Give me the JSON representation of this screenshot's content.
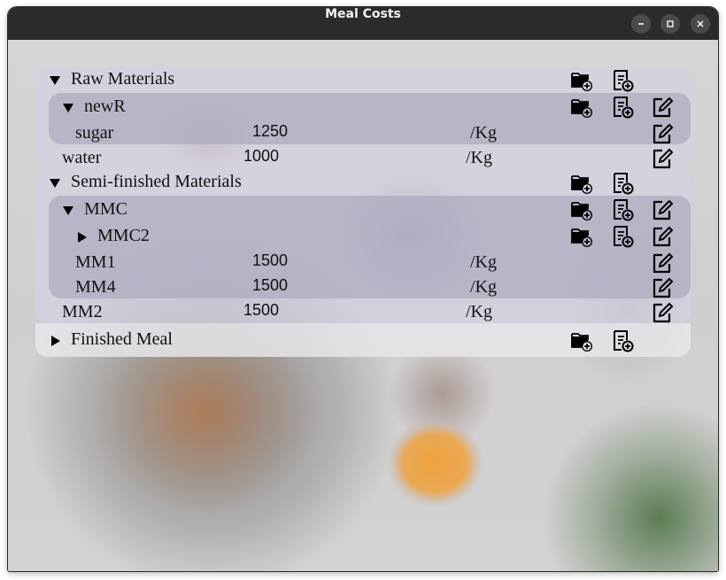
{
  "window": {
    "title": "Meal Costs"
  },
  "tree": {
    "raw": {
      "label": "Raw Materials",
      "children": {
        "newR": {
          "label": "newR",
          "items": [
            {
              "name": "sugar",
              "price": "1250",
              "unit": "/Kg"
            }
          ]
        }
      },
      "items": [
        {
          "name": "water",
          "price": "1000",
          "unit": "/Kg"
        }
      ]
    },
    "semi": {
      "label": "Semi-finished Materials",
      "children": {
        "MMC": {
          "label": "MMC",
          "children": {
            "MMC2": {
              "label": "MMC2"
            }
          },
          "items": [
            {
              "name": "MM1",
              "price": "1500",
              "unit": "/Kg"
            },
            {
              "name": "MM4",
              "price": "1500",
              "unit": "/Kg"
            }
          ]
        }
      },
      "items": [
        {
          "name": "MM2",
          "price": "1500",
          "unit": "/Kg"
        }
      ]
    },
    "finished": {
      "label": "Finished Meal"
    }
  },
  "icons": {
    "add_folder": "add-folder-icon",
    "add_document": "add-document-icon",
    "edit": "edit-icon",
    "expanded": "triangle-down-icon",
    "collapsed": "triangle-right-icon"
  }
}
